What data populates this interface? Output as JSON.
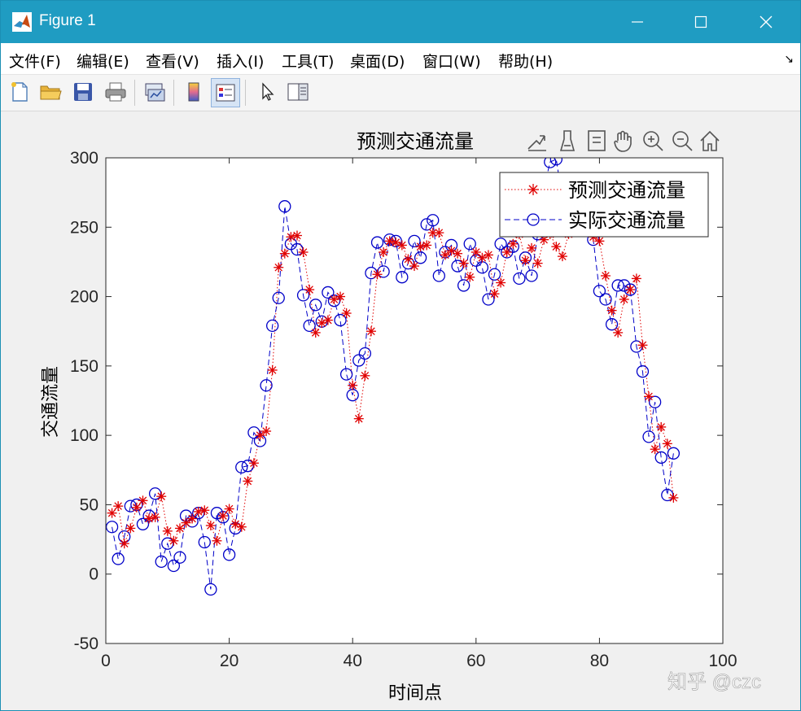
{
  "window": {
    "title": "Figure 1"
  },
  "menubar": {
    "items": [
      "文件(F)",
      "编辑(E)",
      "查看(V)",
      "插入(I)",
      "工具(T)",
      "桌面(D)",
      "窗口(W)",
      "帮助(H)"
    ]
  },
  "toolbar": {
    "buttons": [
      "new-figure",
      "open-file",
      "save",
      "print",
      "link-plot",
      "insert-colorbar",
      "insert-legend",
      "edit-plot-arrow",
      "property-inspector"
    ]
  },
  "axes_toolbar": {
    "buttons": [
      "export-icon",
      "brush-icon",
      "data-tips-icon",
      "pan-icon",
      "zoom-in-icon",
      "zoom-out-icon",
      "home-icon"
    ]
  },
  "watermark": "知乎 @czc",
  "colors": {
    "titlebar": "#1f9cc2",
    "predicted": "#e00000",
    "actual": "#0000c8"
  },
  "chart_data": {
    "type": "line",
    "title": "预测交通流量",
    "xlabel": "时间点",
    "ylabel": "交通流量",
    "xlim": [
      0,
      100
    ],
    "ylim": [
      -50,
      300
    ],
    "xticks": [
      0,
      20,
      40,
      60,
      80,
      100
    ],
    "yticks": [
      -50,
      0,
      50,
      100,
      150,
      200,
      250,
      300
    ],
    "legend_position": "top-right",
    "grid": false,
    "x": [
      1,
      2,
      3,
      4,
      5,
      6,
      7,
      8,
      9,
      10,
      11,
      12,
      13,
      14,
      15,
      16,
      17,
      18,
      19,
      20,
      21,
      22,
      23,
      24,
      25,
      26,
      27,
      28,
      29,
      30,
      31,
      32,
      33,
      34,
      35,
      36,
      37,
      38,
      39,
      40,
      41,
      42,
      43,
      44,
      45,
      46,
      47,
      48,
      49,
      50,
      51,
      52,
      53,
      54,
      55,
      56,
      57,
      58,
      59,
      60,
      61,
      62,
      63,
      64,
      65,
      66,
      67,
      68,
      69,
      70,
      71,
      72,
      73,
      74,
      75,
      76,
      77,
      78,
      79,
      80,
      81,
      82,
      83,
      84,
      85,
      86,
      87,
      88,
      89,
      90,
      91,
      92
    ],
    "series": [
      {
        "name": "预测交通流量",
        "marker": "*",
        "linestyle": "dotted",
        "color": "#e00000",
        "values": [
          44,
          49,
          22,
          33,
          48,
          53,
          40,
          41,
          56,
          31,
          24,
          33,
          37,
          40,
          45,
          46,
          35,
          24,
          42,
          47,
          36,
          34,
          67,
          80,
          100,
          103,
          147,
          221,
          231,
          243,
          244,
          232,
          205,
          174,
          181,
          183,
          198,
          200,
          188,
          136,
          112,
          143,
          175,
          216,
          232,
          240,
          239,
          237,
          227,
          222,
          236,
          237,
          246,
          246,
          230,
          233,
          231,
          224,
          214,
          232,
          228,
          230,
          202,
          210,
          232,
          238,
          245,
          226,
          235,
          224,
          241,
          245,
          236,
          229,
          245,
          247,
          250,
          248,
          243,
          240,
          215,
          190,
          174,
          198,
          205,
          213,
          165,
          128,
          90,
          106,
          94,
          55
        ]
      },
      {
        "name": "实际交通流量",
        "marker": "o",
        "linestyle": "dashed",
        "color": "#0000c8",
        "values": [
          34,
          11,
          27,
          49,
          50,
          36,
          42,
          58,
          9,
          22,
          6,
          12,
          42,
          38,
          44,
          23,
          -11,
          44,
          41,
          14,
          33,
          77,
          78,
          102,
          96,
          136,
          179,
          199,
          265,
          238,
          234,
          201,
          179,
          194,
          182,
          203,
          197,
          183,
          144,
          129,
          154,
          159,
          217,
          239,
          218,
          241,
          240,
          214,
          224,
          240,
          228,
          252,
          255,
          215,
          232,
          237,
          222,
          208,
          238,
          226,
          221,
          198,
          216,
          238,
          232,
          236,
          213,
          228,
          215,
          245,
          278,
          297,
          299,
          270,
          262,
          257,
          255,
          248,
          241,
          204,
          198,
          180,
          208,
          208,
          205,
          164,
          146,
          99,
          124,
          84,
          57,
          87
        ]
      }
    ]
  }
}
